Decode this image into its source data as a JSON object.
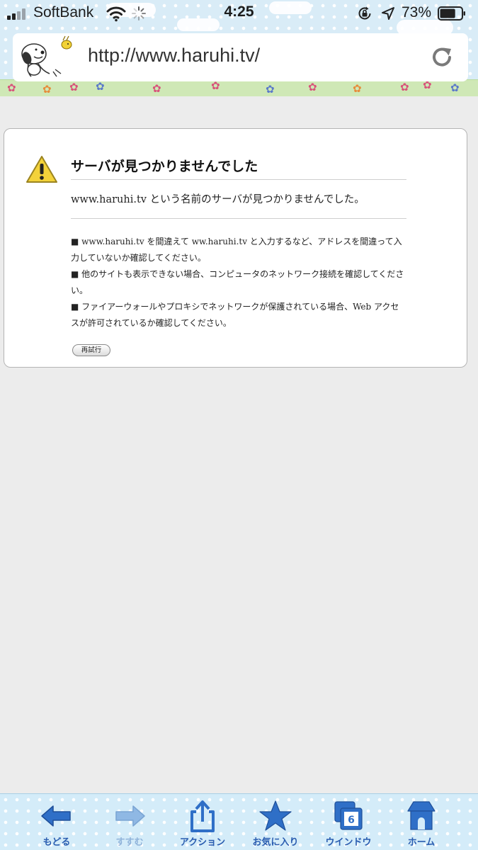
{
  "status_bar": {
    "carrier": "SoftBank",
    "time": "4:25",
    "battery_percent": "73%",
    "battery_level": 0.73
  },
  "address_bar": {
    "url": "http://www.haruhi.tv/"
  },
  "error_page": {
    "title": "サーバが見つかりませんでした",
    "message": "www.haruhi.tv という名前のサーバが見つかりませんでした。",
    "hints": [
      "■ www.haruhi.tv を間違えて ww.haruhi.tv と入力するなど、アドレスを間違って入力していないか確認してください。",
      "■ 他のサイトも表示できない場合、コンピュータのネットワーク接続を確認してください。",
      "■ ファイアーウォールやプロキシでネットワークが保護されている場合、Web アクセスが許可されているか確認してください。"
    ],
    "retry_label": "再試行"
  },
  "toolbar": {
    "back_label": "もどる",
    "forward_label": "すすむ",
    "action_label": "アクション",
    "favorites_label": "お気に入り",
    "window_label": "ウインドウ",
    "window_count": "6",
    "home_label": "ホーム"
  },
  "colors": {
    "toolbar_icon": "#2f6fc7",
    "toolbar_icon_disabled": "#8fb8e4",
    "warning": "#f3d23a"
  }
}
